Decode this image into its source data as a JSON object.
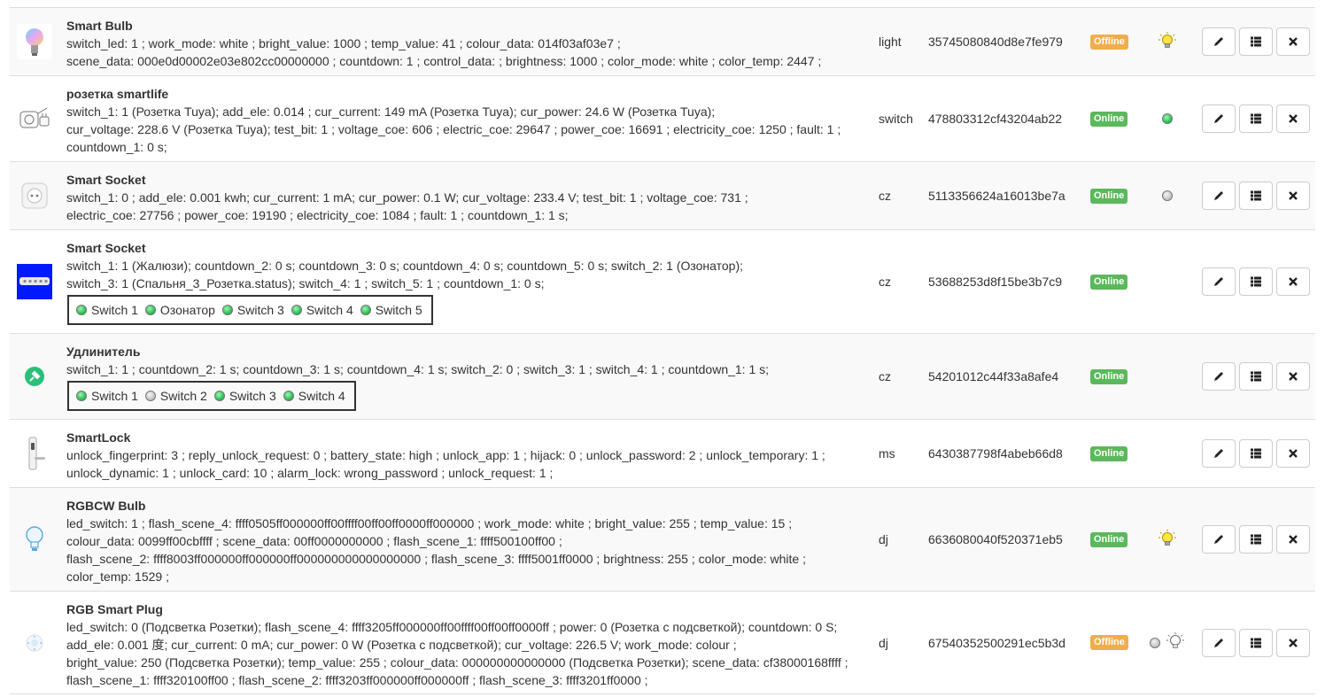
{
  "devices": [
    {
      "name": "Smart Bulb",
      "attrs_line1": "switch_led: 1 ; work_mode: white ; bright_value: 1000 ; temp_value: 41 ; colour_data: 014f03af03e7 ;",
      "attrs_line2": "scene_data: 000e0d00002e03e802cc00000000 ; countdown: 1 ; control_data: ; brightness: 1000 ; color_mode: white ; color_temp: 2447 ;",
      "type": "light",
      "id": "35745080840d8e7fe979",
      "status": "Offline",
      "status_kind": "offline",
      "icon": "bulb-rgb-icon"
    },
    {
      "name": "розетка smartlife",
      "attrs_line1": "switch_1: 1 (Розетка Tuya); add_ele: 0.014 ; cur_current: 149 mA (Розетка Tuya); cur_power: 24.6 W (Розетка Tuya);",
      "attrs_line2": "cur_voltage: 228.6 V (Розетка Tuya); test_bit: 1 ; voltage_coe: 606 ; electric_coe: 29647 ; power_coe: 16691 ; electricity_coe: 1250 ; fault: 1 ;",
      "attrs_line3": "countdown_1: 0 s;",
      "type": "switch",
      "id": "478803312cf43204ab22",
      "status": "Online",
      "status_kind": "online",
      "icon": "socket-plug-icon"
    },
    {
      "name": "Smart Socket",
      "attrs_line1": "switch_1: 0 ; add_ele: 0.001 kwh; cur_current: 1 mA; cur_power: 0.1 W; cur_voltage: 233.4 V; test_bit: 1 ; voltage_coe: 731 ;",
      "attrs_line2": "electric_coe: 27756 ; power_coe: 19190 ; electricity_coe: 1084 ; fault: 1 ; countdown_1: 1 s;",
      "type": "cz",
      "id": "5113356624a16013be7a",
      "status": "Online",
      "status_kind": "online",
      "icon": "wall-socket-icon"
    },
    {
      "name": "Smart Socket",
      "attrs_line1": "switch_1: 1 (Жалюзи); countdown_2: 0 s; countdown_3: 0 s; countdown_4: 0 s; countdown_5: 0 s; switch_2: 1 (Озонатор);",
      "attrs_line2": "switch_3: 1 (Спальня_3_Розетка.status); switch_4: 1 ; switch_5: 1 ; countdown_1: 0 s;",
      "switches": [
        {
          "label": "Switch 1",
          "on": true
        },
        {
          "label": "Озонатор",
          "on": true
        },
        {
          "label": "Switch 3",
          "on": true
        },
        {
          "label": "Switch 4",
          "on": true
        },
        {
          "label": "Switch 5",
          "on": true
        }
      ],
      "type": "cz",
      "id": "53688253d8f15be3b7c9",
      "status": "Online",
      "status_kind": "online",
      "icon": "power-strip-icon"
    },
    {
      "name": "Удлинитель",
      "attrs_line1": "switch_1: 1 ; countdown_2: 1 s; countdown_3: 1 s; countdown_4: 1 s; switch_2: 0 ; switch_3: 1 ; switch_4: 1 ; countdown_1: 1 s;",
      "switches": [
        {
          "label": "Switch 1",
          "on": true
        },
        {
          "label": "Switch 2",
          "on": false
        },
        {
          "label": "Switch 3",
          "on": true
        },
        {
          "label": "Switch 4",
          "on": true
        }
      ],
      "type": "cz",
      "id": "54201012c44f33a8afe4",
      "status": "Online",
      "status_kind": "online",
      "icon": "green-plug-icon"
    },
    {
      "name": "SmartLock",
      "attrs_line1": "unlock_fingerprint: 3 ; reply_unlock_request: 0 ; battery_state: high ; unlock_app: 1 ; hijack: 0 ; unlock_password: 2 ; unlock_temporary: 1 ;",
      "attrs_line2": "unlock_dynamic: 1 ; unlock_card: 10 ; alarm_lock: wrong_password ; unlock_request: 1 ;",
      "type": "ms",
      "id": "6430387798f4abeb66d8",
      "status": "Online",
      "status_kind": "online",
      "icon": "door-lock-icon"
    },
    {
      "name": "RGBCW Bulb",
      "attrs_line1": "led_switch: 1 ; flash_scene_4: ffff0505ff000000ff00ffff00ff00ff0000ff000000 ; work_mode: white ; bright_value: 255 ; temp_value: 15 ;",
      "attrs_line2": "colour_data: 0099ff00cbffff ; scene_data: 00ff0000000000 ; flash_scene_1: ffff500100ff00 ;",
      "attrs_line3": "flash_scene_2: ffff8003ff000000ff000000ff000000000000000000 ; flash_scene_3: ffff5001ff0000 ; brightness: 255 ; color_mode: white ;",
      "attrs_line4": "color_temp: 1529 ;",
      "type": "dj",
      "id": "6636080040f520371eb5",
      "status": "Online",
      "status_kind": "online",
      "icon": "bulb-outline-icon"
    },
    {
      "name": "RGB Smart Plug",
      "attrs_line1": "led_switch: 0 (Подсветка Розетки); flash_scene_4: ffff3205ff000000ff00ffff00ff00ff0000ff ; power: 0 (Розетка с подсветкой); countdown: 0 S;",
      "attrs_line2": "add_ele: 0.001 度; cur_current: 0 mA; cur_power: 0 W (Розетка с подсветкой); cur_voltage: 226.5 V; work_mode: colour ;",
      "attrs_line3": "bright_value: 250 (Подсветка Розетки); temp_value: 255 ; colour_data: 000000000000000 (Подсветка Розетки); scene_data: cf38000168ffff ;",
      "attrs_line4": "flash_scene_1: ffff320100ff00 ; flash_scene_2: ffff3203ff000000ff000000ff ; flash_scene_3: ffff3201ff0000 ;",
      "type": "dj",
      "id": "67540352500291ec5b3d",
      "status": "Offline",
      "status_kind": "offline",
      "icon": "round-plug-icon"
    }
  ],
  "actions": {
    "edit_icon": "pencil-icon",
    "list_icon": "list-icon",
    "delete_icon": "close-icon"
  },
  "colors": {
    "online": "#5cb85c",
    "offline": "#f0ad4e",
    "led_on": "#1fb84a",
    "led_off": "#bbbbbb"
  }
}
